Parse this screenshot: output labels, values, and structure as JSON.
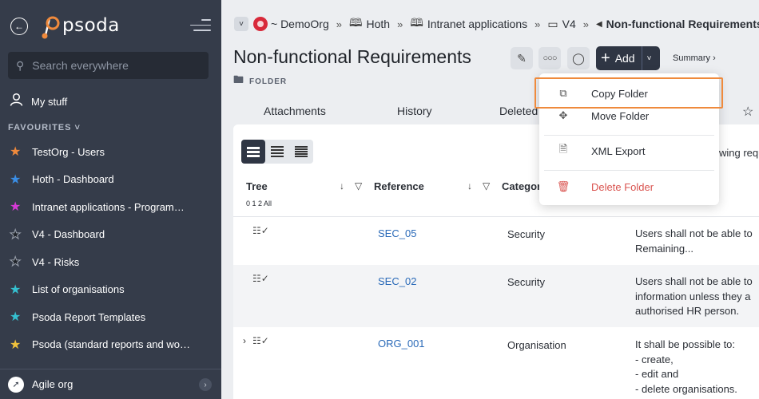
{
  "sidebar": {
    "logo_text": "psoda",
    "search_placeholder": "Search everywhere",
    "my_stuff": "My stuff",
    "favourites_heading": "FAVOURITES",
    "favourites": [
      {
        "label": "TestOrg - Users",
        "color": "#f08a3c"
      },
      {
        "label": "Hoth - Dashboard",
        "color": "#3a8ee6"
      },
      {
        "label": "Intranet applications - Programme Dashboard",
        "color": "#d63ad6"
      },
      {
        "label": "V4 - Dashboard",
        "color": "#1f2329"
      },
      {
        "label": "V4 - Risks",
        "color": "#1f2329"
      },
      {
        "label": "List of organisations",
        "color": "#35c0d0"
      },
      {
        "label": "Psoda Report Templates",
        "color": "#35c0d0"
      },
      {
        "label": "Psoda (standard reports and workflows)",
        "color": "#f0c23c"
      }
    ],
    "org_name": "Agile org"
  },
  "breadcrumb": {
    "org": "~ DemoOrg",
    "items": [
      "Hoth",
      "Intranet applications",
      "V4"
    ],
    "current": "Non-functional Requirements"
  },
  "page": {
    "title": "Non-functional Requirements",
    "type": "FOLDER",
    "add_label": "Add",
    "summary_label": "Summary ›"
  },
  "tabs": [
    "Attachments",
    "History",
    "Deleted"
  ],
  "table": {
    "description_partial": "wing requ",
    "columns": {
      "tree": "Tree",
      "levels": "0 1 2 All",
      "reference": "Reference",
      "category": "Categor"
    },
    "rows": [
      {
        "ref": "SEC_05",
        "category": "Security",
        "desc": [
          "Users shall not be able to",
          "Remaining..."
        ]
      },
      {
        "ref": "SEC_02",
        "category": "Security",
        "desc": [
          "Users shall not be able to",
          "information unless they a",
          "authorised HR person."
        ]
      },
      {
        "ref": "ORG_001",
        "category": "Organisation",
        "desc": [
          "It shall be possible to:",
          "- create,",
          "- edit and",
          "- delete organisations."
        ]
      }
    ]
  },
  "menu": {
    "copy": "Copy Folder",
    "move": "Move Folder",
    "xml": "XML Export",
    "delete": "Delete Folder"
  },
  "colors": {
    "highlight": "#ef8a3c",
    "link": "#2a6ab8",
    "danger": "#d9534f"
  }
}
